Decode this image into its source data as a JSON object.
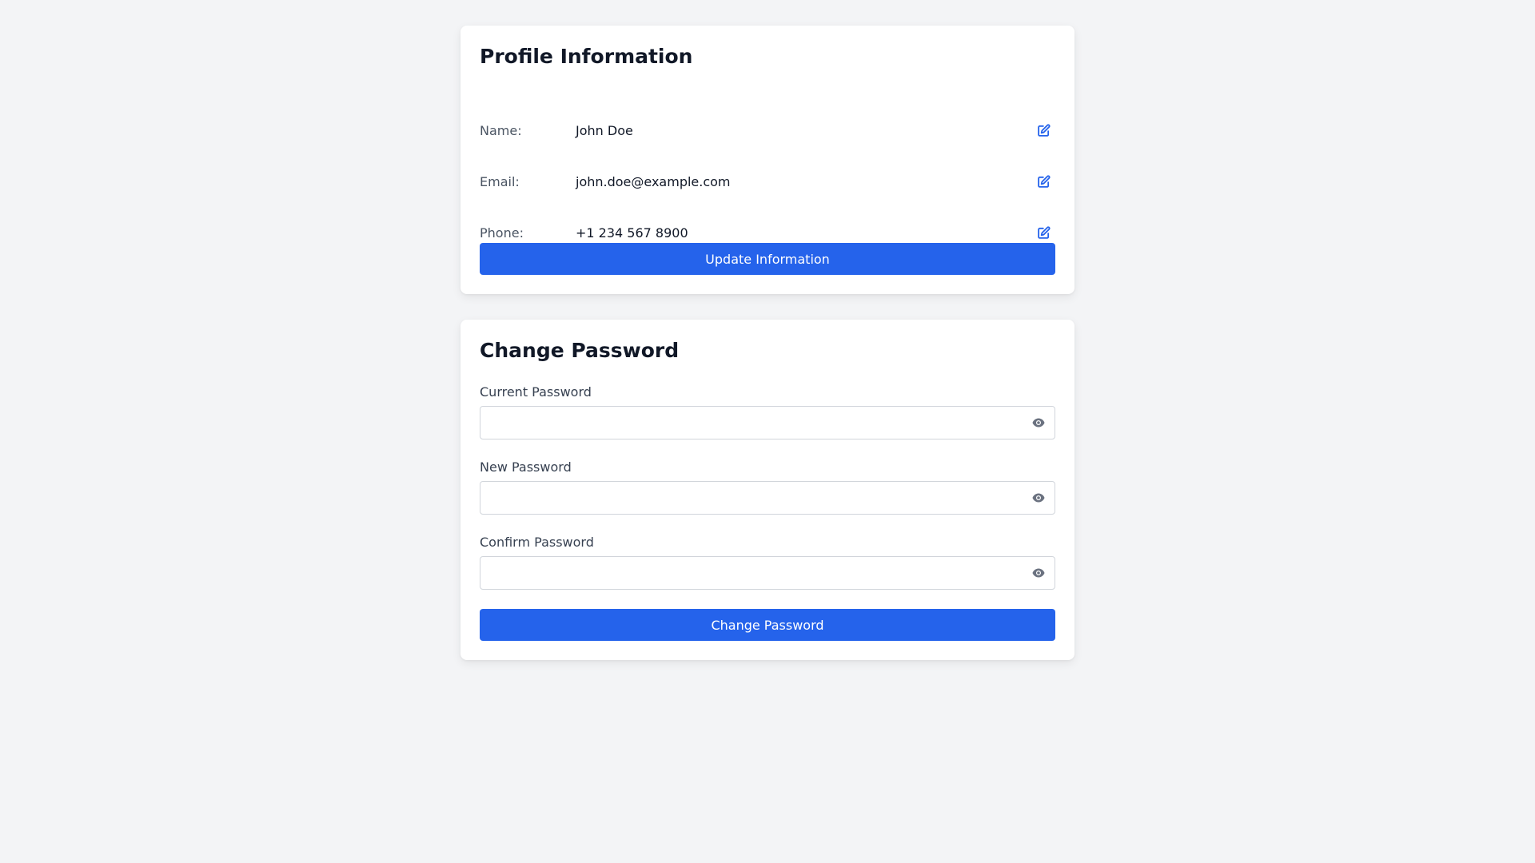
{
  "colors": {
    "accent": "#2563eb",
    "background": "#f3f4f6",
    "card": "#ffffff",
    "label_text": "#4b5563",
    "eye_icon": "#6b7280"
  },
  "profile": {
    "title": "Profile Information",
    "rows": [
      {
        "label": "Name:",
        "value": "John Doe",
        "icon": "edit-icon"
      },
      {
        "label": "Email:",
        "value": "john.doe@example.com",
        "icon": "edit-icon"
      },
      {
        "label": "Phone:",
        "value": "+1 234 567 8900",
        "icon": "edit-icon"
      }
    ],
    "update_button": "Update Information"
  },
  "password": {
    "title": "Change Password",
    "fields": [
      {
        "label": "Current Password",
        "value": "",
        "placeholder": "",
        "icon": "eye-icon"
      },
      {
        "label": "New Password",
        "value": "",
        "placeholder": "",
        "icon": "eye-icon"
      },
      {
        "label": "Confirm Password",
        "value": "",
        "placeholder": "",
        "icon": "eye-icon"
      }
    ],
    "submit_button": "Change Password"
  }
}
